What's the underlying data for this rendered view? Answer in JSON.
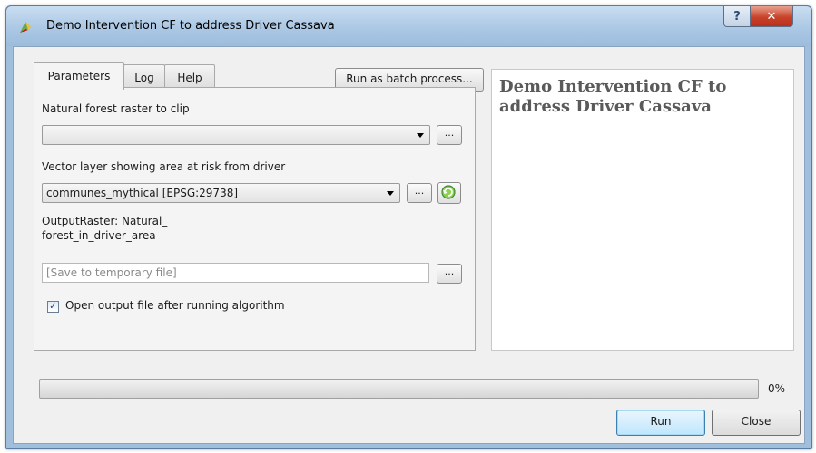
{
  "window": {
    "title": "Demo Intervention CF to address Driver Cassava"
  },
  "titlebar_buttons": {
    "help": "?",
    "close": "✕"
  },
  "tabs": [
    {
      "label": "Parameters",
      "active": true
    },
    {
      "label": "Log",
      "active": false
    },
    {
      "label": "Help",
      "active": false
    }
  ],
  "batch_button": "Run as batch process...",
  "params": {
    "raster_label": "Natural forest raster to clip",
    "raster_value": "",
    "vector_label": "Vector layer showing area at risk from driver",
    "vector_value": "communes_mythical [EPSG:29738]",
    "output_label_line1": "OutputRaster: Natural_",
    "output_label_line2": "forest_in_driver_area",
    "output_placeholder": "[Save to temporary file]",
    "browse_label": "...",
    "open_output_checked": true,
    "open_output_label": "Open output file after running algorithm"
  },
  "help_panel": {
    "title": "Demo Intervention CF to address Driver Cassava"
  },
  "progress": {
    "value": 0,
    "text": "0%"
  },
  "buttons": {
    "run": "Run",
    "close": "Close"
  },
  "colors": {
    "accent": "#3c7fb1",
    "title_bar": "#a9c6e4",
    "close_red": "#c8432b"
  }
}
